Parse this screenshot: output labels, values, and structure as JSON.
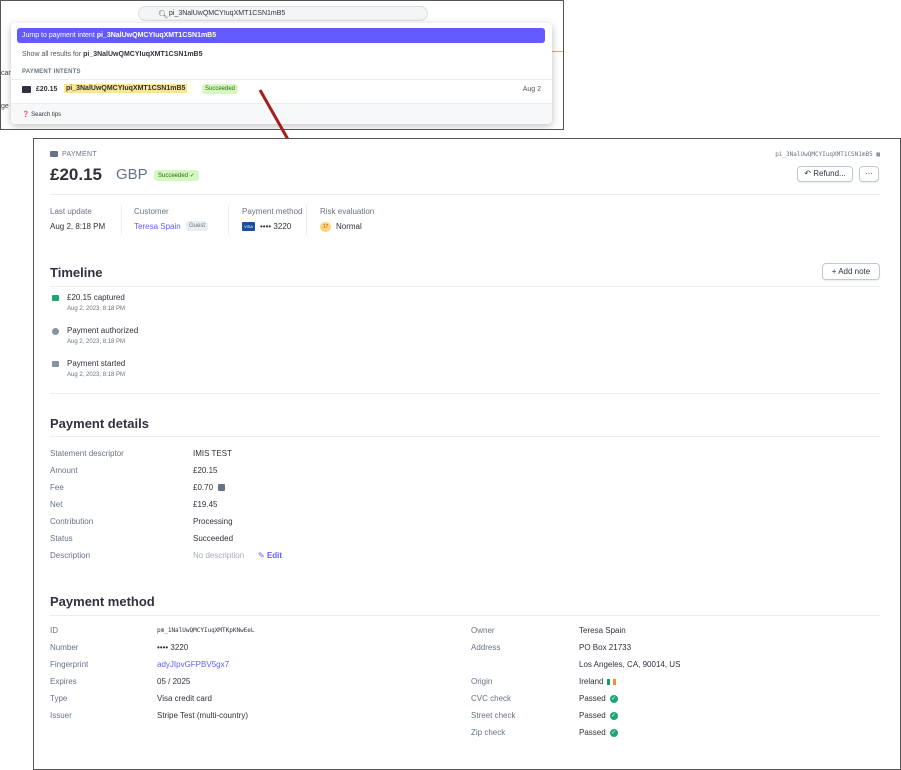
{
  "search": {
    "query": "pi_3NalUwQMCYIuqXMT1CSN1mB5",
    "jump_label": "Jump to payment intent ",
    "jump_id": "pi_3NalUwQMCYIuqXMT1CSN1mB5",
    "show_all_label": "Show all results for ",
    "show_all_id": "pi_3NalUwQMCYIuqXMT1CSN1mB5",
    "section_title": "PAYMENT INTENTS",
    "result": {
      "amount": "£20.15",
      "id": "pi_3NalUwQMCYIuqXMT1CSN1mB5",
      "status": "Succeeded",
      "date": "Aug 2"
    },
    "tips": "Search tips",
    "edge_text_1": "car",
    "edge_text_2": "ge"
  },
  "payment": {
    "kicker": "PAYMENT",
    "id": "pi_3NalUwQMCYIuqXMT1CSN1mB5",
    "amount": "£20.15",
    "currency": "GBP",
    "status": "Succeeded ✓",
    "refund_label": "Refund...",
    "more_label": "···",
    "summary": {
      "last_update_label": "Last update",
      "last_update": "Aug 2, 8:18 PM",
      "customer_label": "Customer",
      "customer": "Teresa Spain",
      "guest": "Guest",
      "method_label": "Payment method",
      "method": "•••• 3220",
      "card_brand": "VISA",
      "risk_label": "Risk evaluation",
      "risk_score": "17",
      "risk": "Normal"
    }
  },
  "timeline": {
    "title": "Timeline",
    "add_note": "Add note",
    "events": [
      {
        "title": "£20.15 captured",
        "time": "Aug 2, 2023, 8:18 PM"
      },
      {
        "title": "Payment authorized",
        "time": "Aug 2, 2023, 8:18 PM"
      },
      {
        "title": "Payment started",
        "time": "Aug 2, 2023, 8:18 PM"
      }
    ]
  },
  "details": {
    "title": "Payment details",
    "rows": [
      {
        "label": "Statement descriptor",
        "value": "IMIS TEST"
      },
      {
        "label": "Amount",
        "value": "£20.15"
      },
      {
        "label": "Fee",
        "value": "£0.70"
      },
      {
        "label": "Net",
        "value": "£19.45"
      },
      {
        "label": "Contribution",
        "value": "Processing"
      },
      {
        "label": "Status",
        "value": "Succeeded"
      },
      {
        "label": "Description",
        "value": "No description"
      }
    ],
    "edit_label": "Edit"
  },
  "method": {
    "title": "Payment method",
    "left": [
      {
        "label": "ID",
        "value": "pm_1NalUwQMCYIuqXMTKpKNwEeL"
      },
      {
        "label": "Number",
        "value": "•••• 3220"
      },
      {
        "label": "Fingerprint",
        "value": "adyJIpvGFPBV5gx7"
      },
      {
        "label": "Expires",
        "value": "05 / 2025"
      },
      {
        "label": "Type",
        "value": "Visa credit card"
      },
      {
        "label": "Issuer",
        "value": "Stripe Test (multi-country)"
      }
    ],
    "right": [
      {
        "label": "Owner",
        "value": "Teresa Spain"
      },
      {
        "label": "Address",
        "value": "PO Box 21733"
      },
      {
        "label": "",
        "value": "Los Angeles, CA, 90014, US"
      },
      {
        "label": "Origin",
        "value": "Ireland"
      },
      {
        "label": "CVC check",
        "value": "Passed"
      },
      {
        "label": "Street check",
        "value": "Passed"
      },
      {
        "label": "Zip check",
        "value": "Passed"
      }
    ]
  },
  "colors": {
    "accent": "#635bff",
    "success_bg": "#d7f7c2",
    "success_fg": "#217005",
    "arrow": "#a51d1d"
  }
}
